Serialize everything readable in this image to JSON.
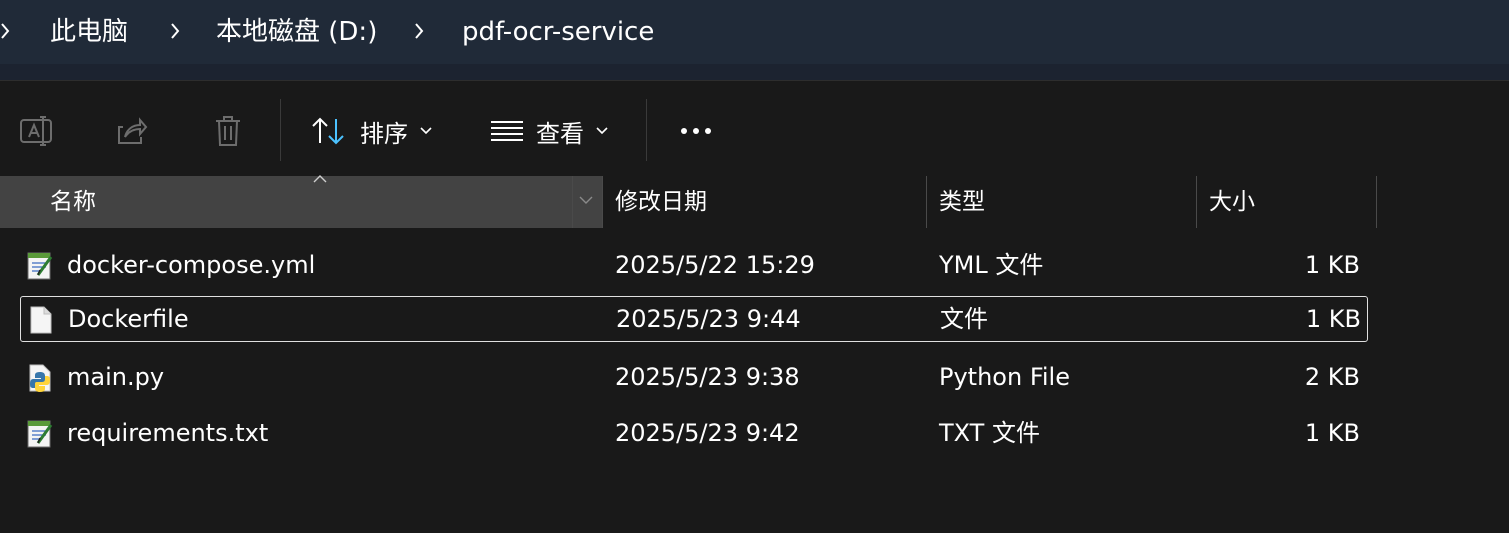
{
  "breadcrumb": {
    "items": [
      "此电脑",
      "本地磁盘 (D:)",
      "pdf-ocr-service"
    ]
  },
  "toolbar": {
    "rename_icon": "rename-icon",
    "share_icon": "share-icon",
    "delete_icon": "trash-icon",
    "sort_label": "排序",
    "view_label": "查看",
    "more_icon": "more-horizontal-icon"
  },
  "columns": {
    "name": "名称",
    "modified": "修改日期",
    "type": "类型",
    "size": "大小"
  },
  "files": [
    {
      "name": "docker-compose.yml",
      "modified": "2025/5/22 15:29",
      "type": "YML 文件",
      "size": "1 KB",
      "icon": "text-document-icon"
    },
    {
      "name": "Dockerfile",
      "modified": "2025/5/23 9:44",
      "type": "文件",
      "size": "1 KB",
      "icon": "blank-file-icon"
    },
    {
      "name": "main.py",
      "modified": "2025/5/23 9:38",
      "type": "Python File",
      "size": "2 KB",
      "icon": "python-file-icon"
    },
    {
      "name": "requirements.txt",
      "modified": "2025/5/23 9:42",
      "type": "TXT 文件",
      "size": "1 KB",
      "icon": "text-document-icon"
    }
  ],
  "colors": {
    "background": "#191919",
    "breadcrumb_bar": "#202a38",
    "name_header": "#434343",
    "sort_accent": "#4cc2ff"
  }
}
